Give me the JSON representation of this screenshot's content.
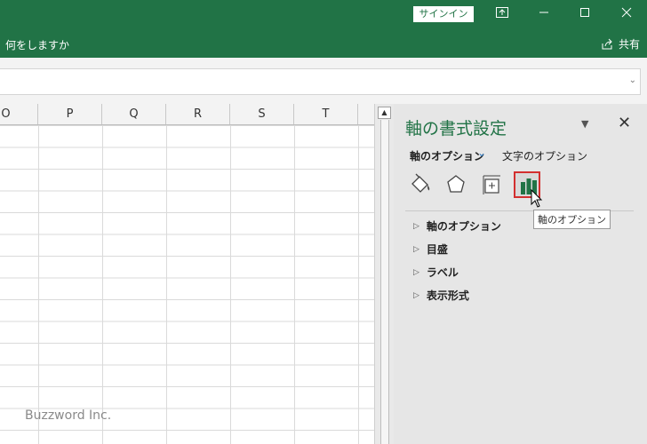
{
  "titlebar": {
    "signin_label": "サインイン",
    "controls": [
      "ribbon-display-icon",
      "minimize-icon",
      "maximize-icon",
      "close-icon"
    ]
  },
  "ribbon": {
    "tellme_label": "何をしますか",
    "share_label": "共有"
  },
  "grid": {
    "columns": [
      "O",
      "P",
      "Q",
      "R",
      "S",
      "T"
    ],
    "watermark": "Buzzword Inc."
  },
  "pane": {
    "title": "軸の書式設定",
    "tabs": {
      "axis_options": "軸のオプション",
      "text_options": "文字のオプション"
    },
    "icons": [
      "fill-line-icon",
      "effects-icon",
      "size-properties-icon",
      "axis-options-icon"
    ],
    "tooltip": "軸のオプション",
    "sections": [
      {
        "label": "軸のオプション"
      },
      {
        "label": "目盛"
      },
      {
        "label": "ラベル"
      },
      {
        "label": "表示形式"
      }
    ]
  },
  "colors": {
    "brand": "#217346",
    "selected_outline": "#d32f2f"
  }
}
